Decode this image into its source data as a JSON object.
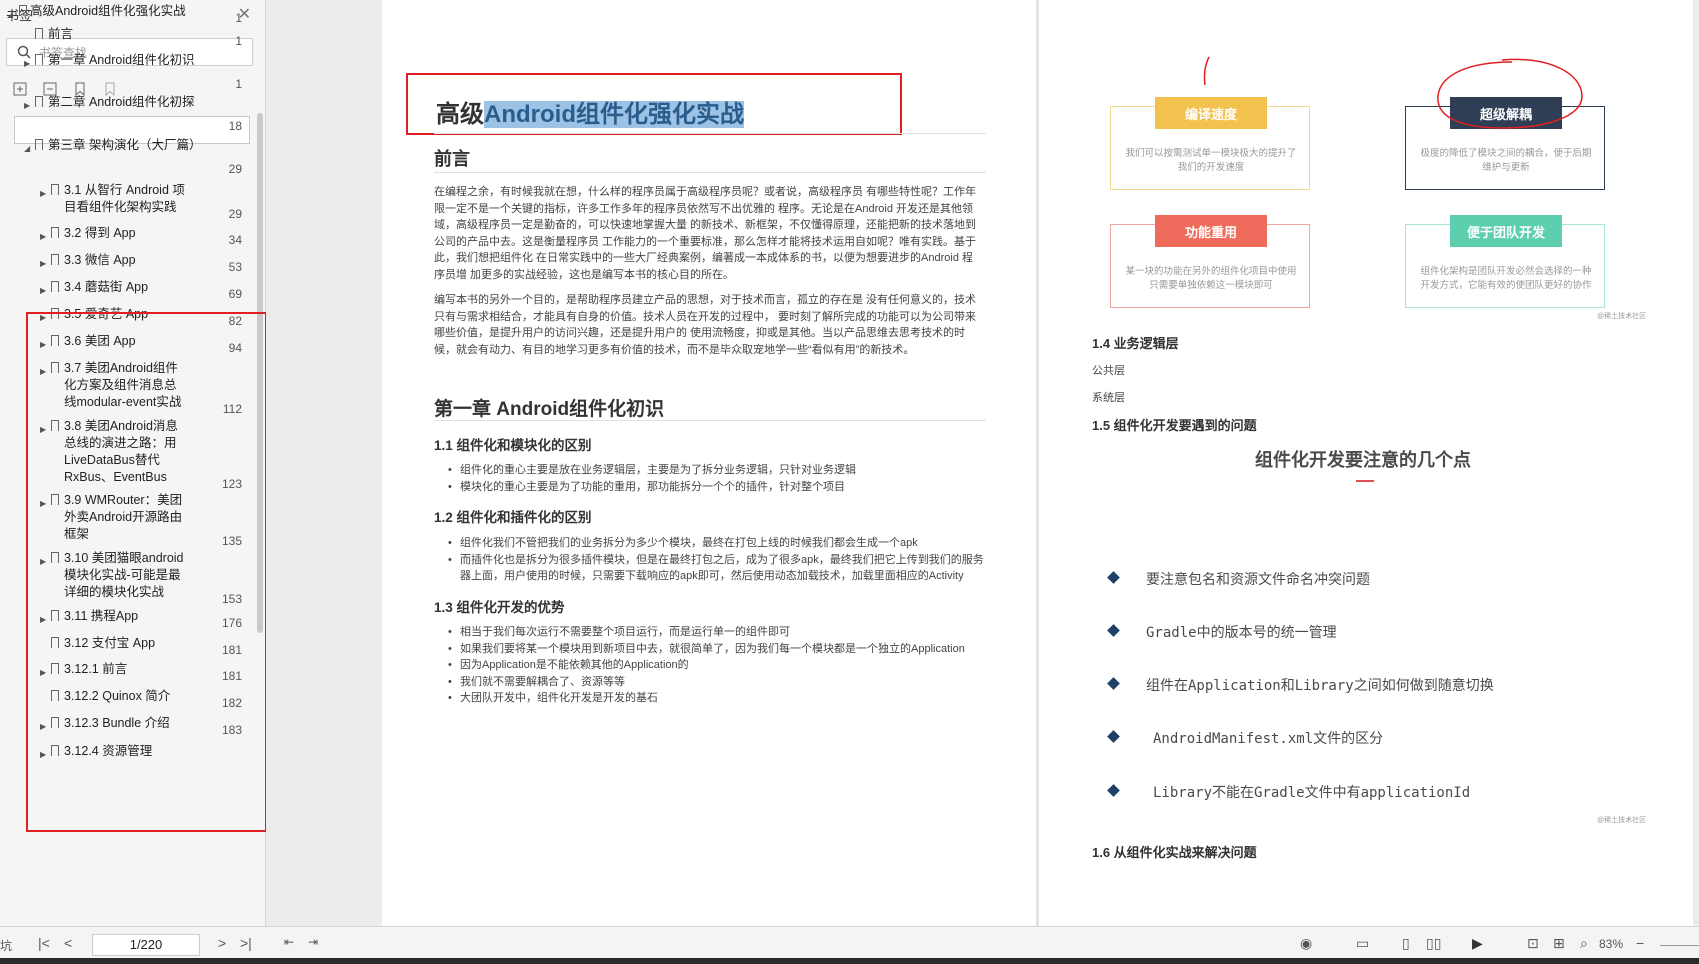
{
  "sidebar": {
    "title": "书签",
    "search_placeholder": "书签查找",
    "items": [
      {
        "label": "高级Android组件化强化实战",
        "page": "1"
      },
      {
        "label": "前言",
        "page": "1"
      },
      {
        "label": "第一章 Android组件化初识",
        "page": "1"
      },
      {
        "label": "第二章 Android组件化初探",
        "page": "18"
      },
      {
        "label": "第三章 架构演化（大厂篇）",
        "page": "29"
      },
      {
        "label": "3.1 从智行 Android 项目看组件化架构实践",
        "page": "29"
      },
      {
        "label": "3.2 得到 App",
        "page": "34"
      },
      {
        "label": "3.3 微信 App",
        "page": "53"
      },
      {
        "label": "3.4 蘑菇街 App",
        "page": "69"
      },
      {
        "label": "3.5 爱奇艺 App",
        "page": "82"
      },
      {
        "label": "3.6 美团 App",
        "page": "94"
      },
      {
        "label": "3.7 美团Android组件化方案及组件消息总线modular-event实战",
        "page": "112"
      },
      {
        "label": "3.8 美团Android消息总线的演进之路：用LiveDataBus替代RxBus、EventBus",
        "page": "123"
      },
      {
        "label": "3.9 WMRouter：美团外卖Android开源路由框架",
        "page": "135"
      },
      {
        "label": "3.10 美团猫眼android模块化实战-可能是最详细的模块化实战",
        "page": "153"
      },
      {
        "label": "3.11 携程App",
        "page": "176"
      },
      {
        "label": "3.12 支付宝 App",
        "page": "181"
      },
      {
        "label": "3.12.1 前言",
        "page": "181"
      },
      {
        "label": "3.12.2 Quinox 简介",
        "page": "182"
      },
      {
        "label": "3.12.3 Bundle 介绍",
        "page": "183"
      },
      {
        "label": "3.12.4 资源管理",
        "page": ""
      }
    ]
  },
  "left_page": {
    "title_plain": "高级",
    "title_selected": "Android组件化强化实战",
    "preface_heading": "前言",
    "preface_p1": "在编程之余，有时候我就在想，什么样的程序员属于高级程序员呢？或者说，高级程序员 有哪些特性呢？工作年限一定不是一个关键的指标，许多工作多年的程序员依然写不出优雅的 程序。无论是在Android 开发还是其他领域，高级程序员一定是勤奋的，可以快速地掌握大量 的新技术、新框架，不仅懂得原理，还能把新的技术落地到公司的产品中去。这是衡量程序员 工作能力的一个重要标准，那么怎样才能将技术运用自如呢？唯有实践。基于此，我们想把组件化 在日常实践中的一些大厂经典案例，编著成一本成体系的书，以便为想要进步的Android 程序员增 加更多的实战经验，这也是编写本书的核心目的所在。",
    "preface_p2": "编写本书的另外一个目的，是帮助程序员建立产品的思想，对于技术而言，孤立的存在是 没有任何意义的，技术只有与需求相结合，才能具有自身的价值。技术人员在开发的过程中， 要时刻了解所完成的功能可以为公司带来哪些价值，是提升用户的访问兴趣，还是提升用户的 使用流畅度，抑或是其他。当以产品思维去思考技术的时候，就会有动力、有目的地学习更多有价值的技术，而不是毕众取宠地学一些“看似有用”的新技术。",
    "chapter1_heading": "第一章 Android组件化初识",
    "s11_heading": "1.1 组件化和模块化的区别",
    "s11_bullets": [
      "组件化的重心主要是放在业务逻辑层，主要是为了拆分业务逻辑，只针对业务逻辑",
      "模块化的重心主要是为了功能的重用，那功能拆分一个个的插件，针对整个项目"
    ],
    "s12_heading": "1.2 组件化和插件化的区别",
    "s12_bullets": [
      "组件化我们不管把我们的业务拆分为多少个模块，最终在打包上线的时候我们都会生成一个apk",
      "而插件化也是拆分为很多插件模块，但是在最终打包之后，成为了很多apk，最终我们把它上传到我们的服务器上面，用户使用的时候，只需要下载响应的apk即可，然后使用动态加载技术，加载里面相应的Activity"
    ],
    "s13_heading": "1.3 组件化开发的优势",
    "s13_bullets": [
      "相当于我们每次运行不需要整个项目运行，而是运行单一的组件即可",
      "如果我们要将某一个模块用到新项目中去，就很简单了，因为我们每一个模块都是一个独立的Application",
      "因为Application是不能依赖其他的Application的",
      "我们就不需要解耦合了、资源等等",
      "大团队开发中，组件化开发是开发的基石"
    ]
  },
  "right_page": {
    "cards": [
      {
        "tag": "编译速度",
        "desc": "我们可以按需测试单一模块极大的提升了我们的开发速度",
        "color": "#f2c14e"
      },
      {
        "tag": "超级解耦",
        "desc": "极度的降低了模块之间的耦合，便于后期维护与更新",
        "color": "#2f3e55"
      },
      {
        "tag": "功能重用",
        "desc": "某一块的功能在另外的组件化项目中使用只需要单独依赖这一模块即可",
        "color": "#ef6b5b"
      },
      {
        "tag": "便于团队开发",
        "desc": "组件化架构是团队开发必然会选择的一种开发方式，它能有效的使团队更好的协作",
        "color": "#5dcfae"
      }
    ],
    "note1": "@稀土技术社区",
    "s14_heading": "1.4 业务逻辑层",
    "s14_items": [
      "公共层",
      "系统层"
    ],
    "s15_heading": "1.5 组件化开发要遇到的问题",
    "slide_title": "组件化开发要注意的几个点",
    "slide_items": [
      "要注意包名和资源文件命名冲突问题",
      "Gradle中的版本号的统一管理",
      "组件在Application和Library之间如何做到随意切换",
      "AndroidManifest.xml文件的区分",
      "Library不能在Gradle文件中有applicationId"
    ],
    "note2": "@稀土技术社区",
    "s16_heading": "1.6 从组件化实战来解决问题"
  },
  "toolbar": {
    "page_indicator": "1/220",
    "zoom": "83%",
    "left_label": "坑"
  },
  "colors": {
    "highlight_border": "#e02020",
    "selection": "#9cc3e6"
  }
}
